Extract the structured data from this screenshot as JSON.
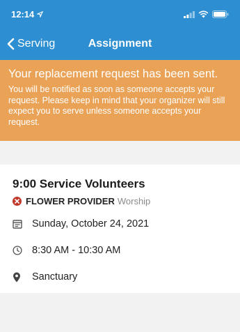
{
  "status_bar": {
    "time": "12:14"
  },
  "nav": {
    "back_label": "Serving",
    "title": "Assignment"
  },
  "banner": {
    "title": "Your replacement request has been sent.",
    "message": "You will be notified as soon as someone accepts your request. Please keep in mind that your organizer will still expect you to serve unless someone accepts your request."
  },
  "service": {
    "title": "9:00 Service Volunteers",
    "role": "FLOWER PROVIDER",
    "team": "Worship",
    "date": "Sunday, October 24, 2021",
    "time": "8:30 AM - 10:30 AM",
    "location": "Sanctuary"
  },
  "colors": {
    "header": "#2d8fd1",
    "banner": "#eaa257",
    "declined": "#c0392b"
  },
  "icons": [
    "location-arrow-icon",
    "signal-icon",
    "wifi-icon",
    "battery-icon",
    "chevron-left-icon",
    "declined-x-icon",
    "calendar-icon",
    "clock-icon",
    "location-pin-icon"
  ]
}
